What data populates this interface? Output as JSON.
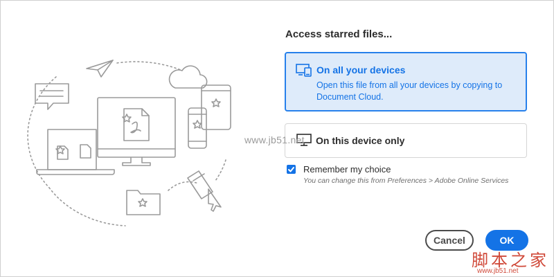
{
  "dialog": {
    "title": "Access starred files...",
    "options": [
      {
        "title": "On all your devices",
        "description": "Open this file from all your devices by copying to Document Cloud.",
        "icon": "devices-icon",
        "selected": true
      },
      {
        "title": "On this device only",
        "icon": "monitor-icon",
        "selected": false
      }
    ],
    "remember": {
      "label": "Remember my choice",
      "hint": "You can change this from Preferences > Adobe Online Services",
      "checked": true
    },
    "buttons": {
      "cancel": "Cancel",
      "ok": "OK"
    }
  },
  "watermark": {
    "site": "www.jb51.net",
    "cn": "脚本之家",
    "url": "www.jb51.net"
  },
  "colors": {
    "accent": "#1473e6",
    "selected_bg": "#deebfa",
    "illustration_stroke": "#9a9a9a"
  }
}
